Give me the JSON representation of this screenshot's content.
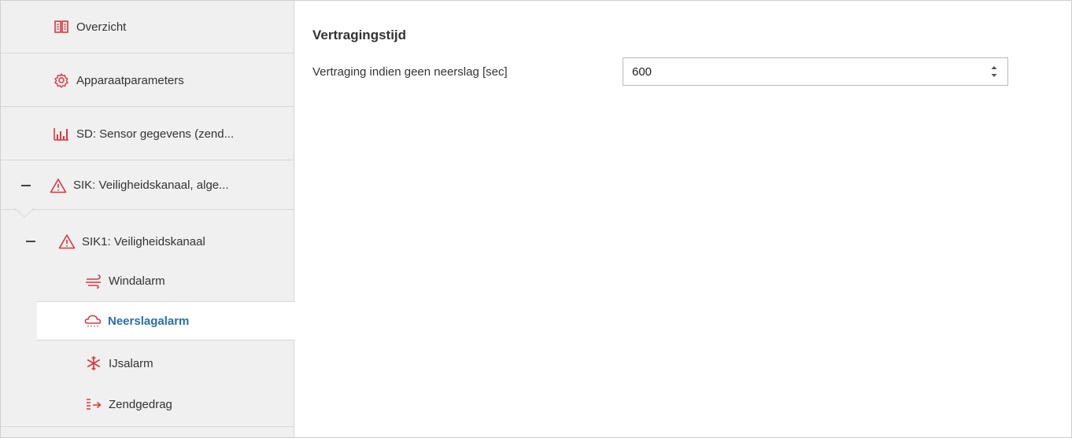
{
  "sidebar": {
    "items": [
      {
        "label": "Overzicht",
        "icon": "book-icon"
      },
      {
        "label": "Apparaatparameters",
        "icon": "gear-icon"
      },
      {
        "label": "SD: Sensor gegevens (zend...",
        "icon": "bar-chart-icon"
      },
      {
        "label": "SIK: Veiligheidskanaal, alge...",
        "icon": "warning-icon"
      },
      {
        "label": "SIK1:  Veiligheidskanaal",
        "icon": "warning-icon"
      },
      {
        "label": "Windalarm",
        "icon": "wind-icon"
      },
      {
        "label": "Neerslagalarm",
        "icon": "rain-cloud-icon"
      },
      {
        "label": "IJsalarm",
        "icon": "snowflake-icon"
      },
      {
        "label": "Zendgedrag",
        "icon": "send-icon"
      }
    ],
    "selected_index": 6
  },
  "main": {
    "section_title": "Vertragingstijd",
    "field_label": "Vertraging indien geen neerslag [sec]",
    "field_value": "600"
  },
  "colors": {
    "accent": "#2a6db0",
    "icon_red": "#d9363e",
    "sidebar_bg": "#f0f0f0"
  }
}
